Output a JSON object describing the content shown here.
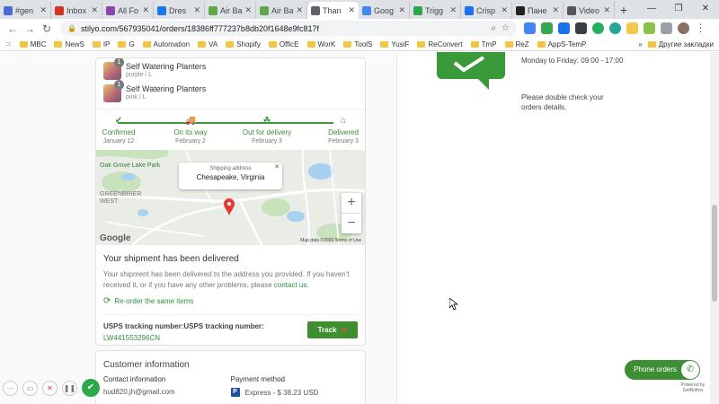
{
  "tabs": [
    {
      "label": "#gen",
      "color": "#4a6bd6"
    },
    {
      "label": "Inbox",
      "color": "#d93025"
    },
    {
      "label": "All Fo",
      "color": "#8e44ad"
    },
    {
      "label": "Dres",
      "color": "#1877f2"
    },
    {
      "label": "Air Ba",
      "color": "#5fa84a"
    },
    {
      "label": "Air Ba",
      "color": "#5fa84a"
    },
    {
      "label": "Than",
      "color": "#5f6368",
      "active": true
    },
    {
      "label": "Goog",
      "color": "#4285f4"
    },
    {
      "label": "Trigg",
      "color": "#2aa84a"
    },
    {
      "label": "Crisp",
      "color": "#1972f5"
    },
    {
      "label": "Пане",
      "color": "#222222"
    },
    {
      "label": "Video",
      "color": "#555555"
    }
  ],
  "address": {
    "url": "stilyo.com/567935041/orders/18386ff777237b8db20f1648e9fc817f"
  },
  "bookmarks": [
    "MBC",
    "NewS",
    "IP",
    "G",
    "Automation",
    "VA",
    "Shopify",
    "OfficE",
    "WorK",
    "ToolS",
    "YusiF",
    "ReConvert",
    "TmP",
    "ReZ",
    "AppS-TemP"
  ],
  "bookmarks_more": "Другие закладки",
  "items": [
    {
      "qty": "1",
      "name": "Self Watering Planters",
      "variant": "purple / L"
    },
    {
      "qty": "1",
      "name": "Self Watering Planters",
      "variant": "pink / L"
    }
  ],
  "steps": [
    {
      "icon": "✔",
      "label": "Confirmed",
      "date": "January 12"
    },
    {
      "icon": "🚚",
      "label": "On its way",
      "date": "February 2"
    },
    {
      "icon": "☘",
      "label": "Out for delivery",
      "date": "February 3"
    },
    {
      "icon": "⌂",
      "label": "Delivered",
      "date": "February 3"
    }
  ],
  "map": {
    "popup_title": "Shipping address",
    "popup_value": "Chesapeake, Virginia",
    "park_label": "Oak Grove Lake Park",
    "area_label": "GREENBRIER WEST",
    "google": "Google",
    "footer": "Map data ©2020   Terms of Use"
  },
  "shipment": {
    "heading": "Your shipment has been delivered",
    "text": "Your shipment has been delivered to the address you provided. If you haven't received it, or if you have any other problems, please",
    "contact_link": "contact us",
    "reorder": "Re-order the same items",
    "tracking_label": "USPS tracking number:USPS tracking number:",
    "tracking_number": "LW441553296CN",
    "track_button": "Track"
  },
  "customer": {
    "heading": "Customer information",
    "contact_label": "Contact information",
    "contact_value": "hud820.jh@gmail.com",
    "payment_label": "Payment method",
    "payment_value": "Express - $ 38.23 USD"
  },
  "right": {
    "hours": "Monday to Friday: 09:00 - 17:00",
    "note": "Please double check your orders details."
  },
  "phone_button": "Phone orders",
  "powered": "Powered by GetButton"
}
